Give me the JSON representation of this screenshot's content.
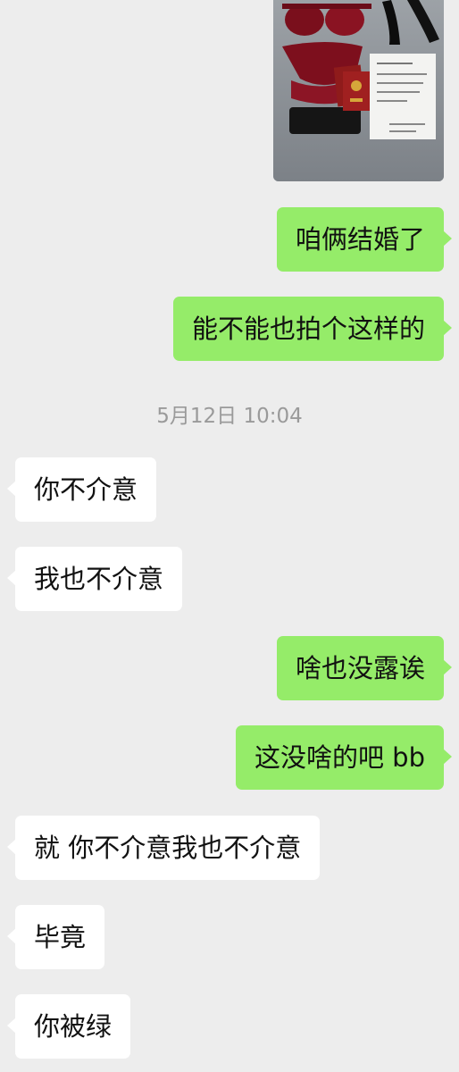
{
  "messages": [
    {
      "side": "out",
      "text": "咱俩结婚了"
    },
    {
      "side": "out",
      "text": "能不能也拍个这样的"
    },
    {
      "side": "in",
      "text": "你不介意"
    },
    {
      "side": "in",
      "text": "我也不介意"
    },
    {
      "side": "out",
      "text": "啥也没露诶"
    },
    {
      "side": "out",
      "text": "这没啥的吧 bb"
    },
    {
      "side": "in",
      "text": "就 你不介意我也不介意"
    },
    {
      "side": "in",
      "text": "毕竟"
    },
    {
      "side": "in",
      "text": "你被绿"
    }
  ],
  "timestamp": "5月12日 10:04",
  "image_message": {
    "description_icons": [
      "lingerie-icon",
      "heels-icon",
      "marriage-certificate-icon",
      "handwritten-note-icon"
    ]
  },
  "colors": {
    "background": "#ededed",
    "outgoing_bubble": "#95ec69",
    "incoming_bubble": "#ffffff",
    "timestamp_text": "#9a9a9a"
  }
}
